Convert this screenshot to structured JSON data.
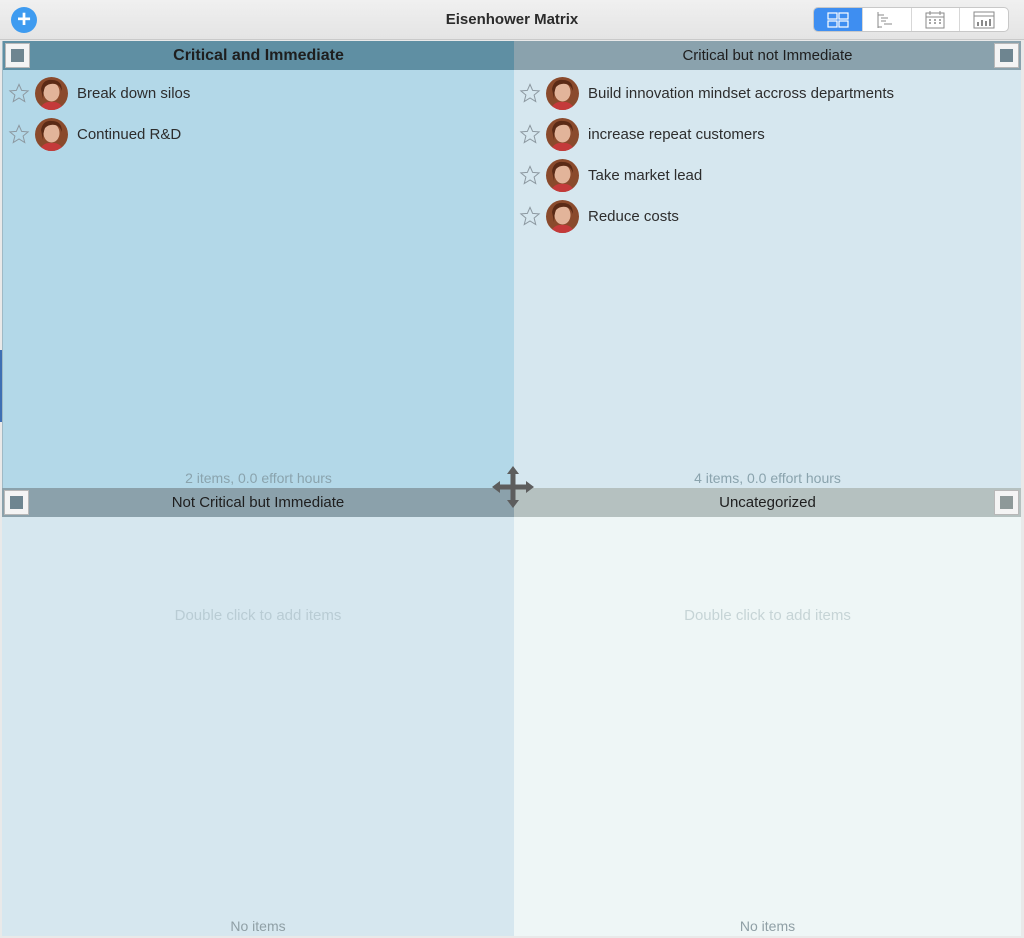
{
  "window": {
    "title": "Eisenhower Matrix"
  },
  "toolbar": {
    "add_icon": "plus-circle-icon",
    "views": [
      {
        "name": "matrix-view",
        "icon": "grid-icon",
        "active": true
      },
      {
        "name": "outline-view",
        "icon": "outline-icon",
        "active": false
      },
      {
        "name": "calendar-view",
        "icon": "calendar-icon",
        "active": false
      },
      {
        "name": "report-view",
        "icon": "chart-icon",
        "active": false
      }
    ]
  },
  "quadrants": {
    "q1": {
      "title": "Critical and Immediate",
      "items": [
        "Break down silos",
        "Continued R&D"
      ],
      "footer": "2 items, 0.0 effort hours",
      "color": "#b3d8e8"
    },
    "q2": {
      "title": "Critical but not Immediate",
      "items": [
        "Build innovation mindset accross departments",
        "increase repeat customers",
        "Take market lead",
        "Reduce costs"
      ],
      "footer": "4 items, 0.0 effort hours",
      "color": "#d6e7ef"
    },
    "q3": {
      "title": "Not Critical but Immediate",
      "hint": "Double click to add items",
      "footer": "No items",
      "color": "#d6e7ef"
    },
    "q4": {
      "title": "Uncategorized",
      "hint": "Double click to add items",
      "footer": "No items",
      "color": "#eef6f6"
    }
  },
  "colors": {
    "accent": "#3e8ef1",
    "q1_header": "#5f8fa3"
  }
}
